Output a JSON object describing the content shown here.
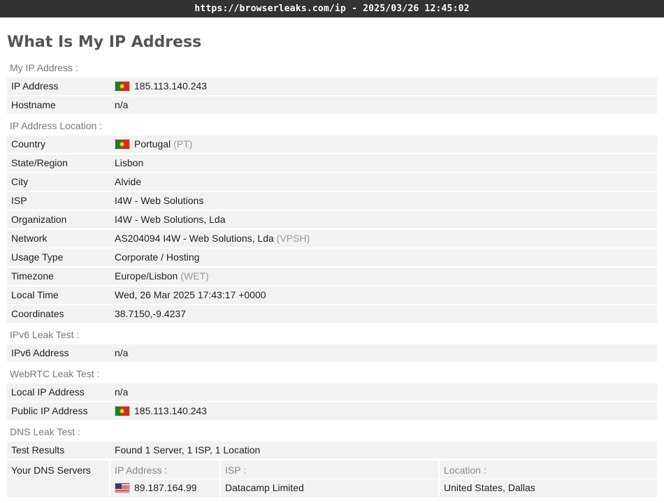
{
  "browser": {
    "url_bar": "https://browserleaks.com/ip - 2025/03/26 12:45:02"
  },
  "page": {
    "title": "What Is My IP Address"
  },
  "sections": {
    "my_ip": "My IP Address :",
    "location": "IP Address Location :",
    "ipv6": "IPv6 Leak Test :",
    "webrtc": "WebRTC Leak Test :",
    "dns": "DNS Leak Test :"
  },
  "ip": {
    "address_label": "IP Address",
    "address_value": "185.113.140.243",
    "hostname_label": "Hostname",
    "hostname_value": "n/a"
  },
  "location": {
    "country_label": "Country",
    "country_value": "Portugal",
    "country_code": "(PT)",
    "state_label": "State/Region",
    "state_value": "Lisbon",
    "city_label": "City",
    "city_value": "Alvide",
    "isp_label": "ISP",
    "isp_value": "I4W - Web Solutions",
    "org_label": "Organization",
    "org_value": "I4W - Web Solutions, Lda",
    "network_label": "Network",
    "network_value": "AS204094 I4W - Web Solutions, Lda",
    "network_tag": "(VPSH)",
    "usage_label": "Usage Type",
    "usage_value": "Corporate / Hosting",
    "tz_label": "Timezone",
    "tz_value": "Europe/Lisbon",
    "tz_abbr": "(WET)",
    "localtime_label": "Local Time",
    "localtime_value": "Wed, 26 Mar 2025 17:43:17 +0000",
    "coords_label": "Coordinates",
    "coords_value": "38.7150,-9.4237"
  },
  "ipv6": {
    "address_label": "IPv6 Address",
    "address_value": "n/a"
  },
  "webrtc": {
    "local_label": "Local IP Address",
    "local_value": "n/a",
    "public_label": "Public IP Address",
    "public_value": "185.113.140.243"
  },
  "dns": {
    "results_label": "Test Results",
    "results_value": "Found 1 Server, 1 ISP, 1 Location",
    "servers_label": "Your DNS Servers",
    "col_ip": "IP Address :",
    "col_isp": "ISP :",
    "col_location": "Location :",
    "server_ip": "89.187.164.99",
    "server_isp": "Datacamp Limited",
    "server_location": "United States, Dallas"
  },
  "icons": {
    "pt_flag": "portugal-flag-icon",
    "us_flag": "usa-flag-icon"
  },
  "colors": {
    "topbar": "#333333",
    "row_bg": "#f2f2f2",
    "section_text": "#777777",
    "muted": "#999999"
  }
}
